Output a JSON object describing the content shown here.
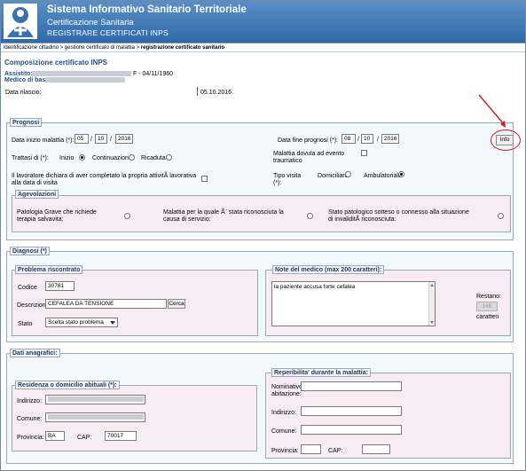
{
  "header": {
    "title": "Sistema Informativo Sanitario Territoriale",
    "subtitle": "Certificazione Sanitaria",
    "section": "REGISTRARE CERTIFICATI INPS"
  },
  "breadcrumb": {
    "item1": "identificazione cittadino",
    "sep": " > ",
    "item2": "gestione certificato di malattia",
    "current": "registrazione certificato sanitario"
  },
  "composition": {
    "title": "Composizione certificato INPS",
    "assistito_label": "Assistito:",
    "assistito_suffix": "F - 04/11/1960",
    "medico_label": "Medico di base",
    "data_rilascio_label": "Data rilascio:",
    "data_rilascio_value": "05.10.2016"
  },
  "prognosi": {
    "legend": "Prognosi",
    "data_inizio_label": "Data inizio malattia (*):",
    "inizio_dd": "05",
    "inizio_mm": "10",
    "inizio_yyyy": "2016",
    "data_fine_label": "Data fine prognosi (*):",
    "fine_dd": "08",
    "fine_mm": "10",
    "fine_yyyy": "2016",
    "info_button": "Info",
    "trattasi_label": "Trattasi di (*):",
    "opt_inizio": "Inizio",
    "opt_continuazione": "Continuazione",
    "opt_ricaduta": "Ricaduta",
    "malattia_evento_label": "Malattia dovuta ad evento traumatico",
    "lavoratore_label": "Il lavoratore dichiara di aver completato la propria attivitÃ  lavorativa alla data di visita",
    "tipo_visita_label": "Tipo visita (*):",
    "opt_domiciliare": "Domiciliare",
    "opt_ambulatoriale": "Ambulatoriale"
  },
  "agevolazioni": {
    "legend": "Agevolazioni",
    "item1": "Patologia Grave che richiede terapia salvavita:",
    "item2": "Malattia per la quale Ã¨ stata riconosciuta la causa di servizio:",
    "item3": "Stato patologico sotteso o connesso alla situazione di invaliditÃ  riconosciuta:"
  },
  "diagnosi": {
    "legend": "Diagnosi (*)",
    "problema_legend": "Problema riscontrato",
    "codice_label": "Codice",
    "codice_value": "30781",
    "descrizione_label": "Descrizione",
    "descrizione_value": "CEFALEA DA TENSIONE",
    "cerca_button": "Cerca",
    "stato_label": "Stato",
    "stato_value": "Scelta stato problema",
    "note_legend": "Note del medico (max 200 caratteri):",
    "note_value": "la paziente accusa forte cefalea",
    "restano_label": "Restano:",
    "restano_value": "168",
    "caratteri_label": "caratteri"
  },
  "anagrafici": {
    "legend": "Dati anagrafici:",
    "residenza_legend": "Residenza o domicilio abituali (*):",
    "indirizzo_label": "Indirizzo:",
    "comune_label": "Comune:",
    "provincia_label": "Provincia:",
    "provincia_value": "BA",
    "cap_label": "CAP:",
    "cap_value": "70017",
    "reperibilita_legend": "Reperibilita' durante la malattia:",
    "nominativo_label": "Nominativo abitazione:",
    "rep_indirizzo_label": "Indirizzo:",
    "rep_comune_label": "Comune:",
    "rep_provincia_label": "Provincia:",
    "rep_cap_label": "CAP:"
  },
  "colors": {
    "header_blue": "#2f6aa8",
    "legend_text": "#1f3c6b",
    "annotation_red": "#d11a1a"
  }
}
